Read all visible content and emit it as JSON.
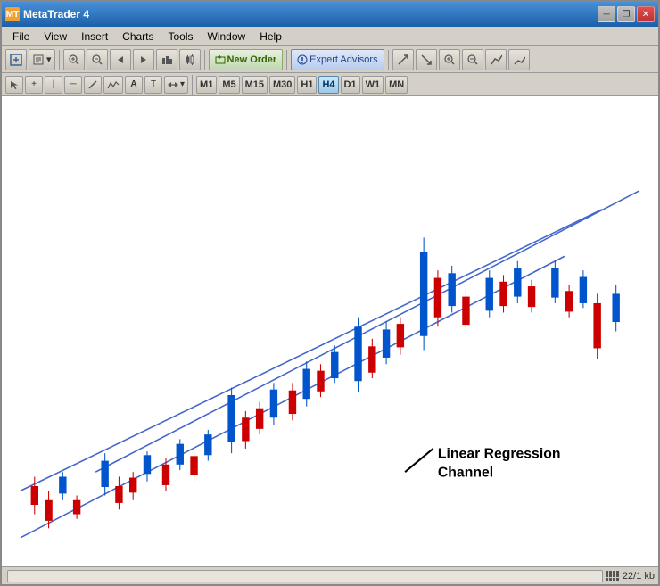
{
  "window": {
    "title": "MetaTrader 4",
    "title_icon": "MT",
    "controls": {
      "minimize": "─",
      "restore": "❐",
      "close": "✕"
    }
  },
  "menu": {
    "items": [
      "File",
      "View",
      "Insert",
      "Charts",
      "Tools",
      "Window",
      "Help"
    ]
  },
  "toolbar": {
    "new_order": "New Order",
    "expert_advisors": "Expert Advisors"
  },
  "periods": {
    "items": [
      "M1",
      "M5",
      "M15",
      "M30",
      "H1",
      "H4",
      "D1",
      "W1",
      "MN"
    ],
    "active": "H4"
  },
  "chart": {
    "label": "Linear Regression\nChannel",
    "annotation_line": true
  },
  "statusbar": {
    "info": "22/1 kb"
  }
}
